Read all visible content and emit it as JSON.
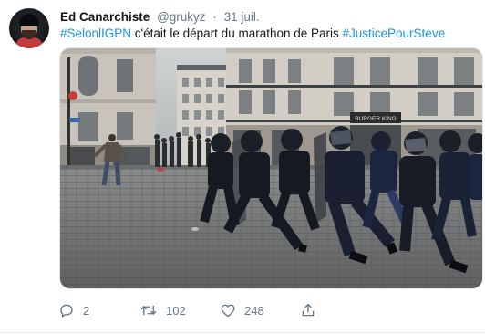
{
  "tweet": {
    "author_name": "Ed Canarchiste",
    "handle": "@grukyz",
    "separator": "·",
    "date": "31 juil.",
    "text_parts": {
      "hashtag1": "#SelonlIGPN",
      "middle": " c'était le départ du marathon de Paris ",
      "hashtag2": "#JusticePourSteve"
    },
    "media": {
      "shop_sign": "BURGER KING"
    },
    "actions": {
      "reply_count": "2",
      "retweet_count": "102",
      "like_count": "248"
    }
  },
  "colors": {
    "link": "#1b95e0",
    "muted": "#657786",
    "text": "#14171a",
    "border": "#e6ecf0"
  },
  "icons": {
    "reply": "reply-icon",
    "retweet": "retweet-icon",
    "like": "heart-icon",
    "share": "share-icon"
  }
}
